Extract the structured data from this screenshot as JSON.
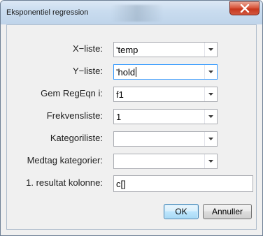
{
  "window": {
    "title": "Eksponentiel regression",
    "close_icon": "close-icon"
  },
  "form": {
    "x_list": {
      "label": "X−liste:",
      "value": "'temp"
    },
    "y_list": {
      "label": "Y−liste:",
      "value": "'hold"
    },
    "save_regeqn": {
      "label": "Gem RegEqn i:",
      "value": "f1"
    },
    "frequency_list": {
      "label": "Frekvensliste:",
      "value": "1"
    },
    "category_list": {
      "label": "Kategoriliste:",
      "value": ""
    },
    "include_categories": {
      "label": "Medtag kategorier:",
      "value": ""
    },
    "first_result_column": {
      "label": "1. resultat kolonne:",
      "value": "c[]"
    }
  },
  "buttons": {
    "ok_label": "OK",
    "cancel_label": "Annuller"
  },
  "colors": {
    "title_bar": "#c9dcef",
    "close_button": "#d9573d",
    "focus_border": "#3399ff",
    "default_button_border": "#3c7fb1"
  }
}
